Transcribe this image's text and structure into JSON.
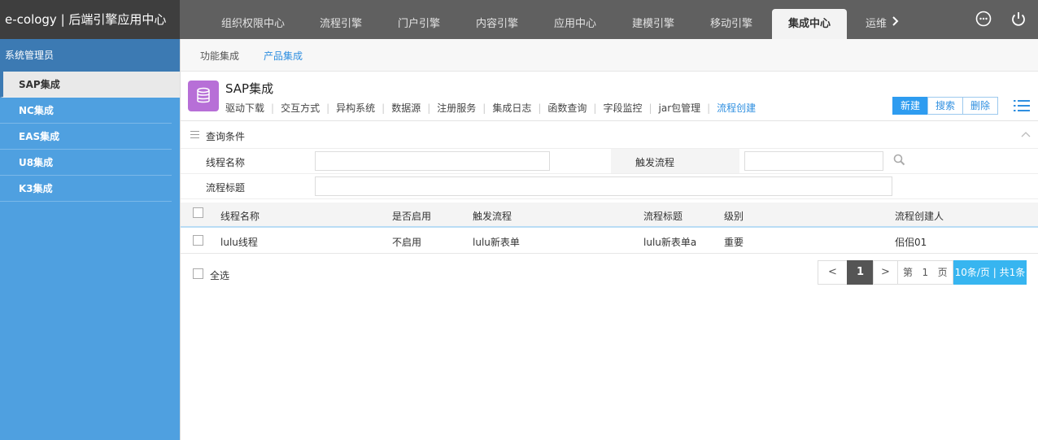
{
  "header": {
    "brand": "e-cology | 后端引擎应用中心",
    "tabs": [
      "组织权限中心",
      "流程引擎",
      "门户引擎",
      "内容引擎",
      "应用中心",
      "建模引擎",
      "移动引擎",
      "集成中心",
      "运维"
    ],
    "active_tab": "集成中心"
  },
  "sidebar": {
    "title": "系统管理员",
    "items": [
      "SAP集成",
      "NC集成",
      "EAS集成",
      "U8集成",
      "K3集成"
    ],
    "active": "SAP集成"
  },
  "subnav": {
    "tabs": [
      "功能集成",
      "产品集成"
    ],
    "active": "产品集成"
  },
  "page": {
    "title": "SAP集成",
    "tabs": [
      "驱动下载",
      "交互方式",
      "异构系统",
      "数据源",
      "注册服务",
      "集成日志",
      "函数查询",
      "字段监控",
      "jar包管理",
      "流程创建"
    ],
    "active_tab": "流程创建",
    "buttons": {
      "new": "新建",
      "search": "搜索",
      "delete": "删除"
    }
  },
  "search": {
    "title": "查询条件",
    "fields": {
      "thread_name": {
        "label": "线程名称",
        "value": ""
      },
      "trigger_flow": {
        "label": "触发流程",
        "value": ""
      },
      "flow_title": {
        "label": "流程标题",
        "value": ""
      }
    }
  },
  "table": {
    "columns": [
      "线程名称",
      "是否启用",
      "触发流程",
      "流程标题",
      "级别",
      "流程创建人"
    ],
    "rows": [
      [
        "lulu线程",
        "不启用",
        "lulu新表单",
        "lulu新表单a",
        "重要",
        "佀佀01"
      ]
    ]
  },
  "footer": {
    "select_all": "全选",
    "pager": {
      "prev": "<",
      "next": ">",
      "current_page": "1",
      "page_prefix": "第",
      "page_input": "1",
      "page_suffix": "页",
      "summary": "10条/页 | 共1条"
    }
  },
  "colors": {
    "sidebar": "#4fa0e0",
    "sidebar_header": "#3c7ab3",
    "accent": "#2f8fe0",
    "topbar": "#606060"
  }
}
